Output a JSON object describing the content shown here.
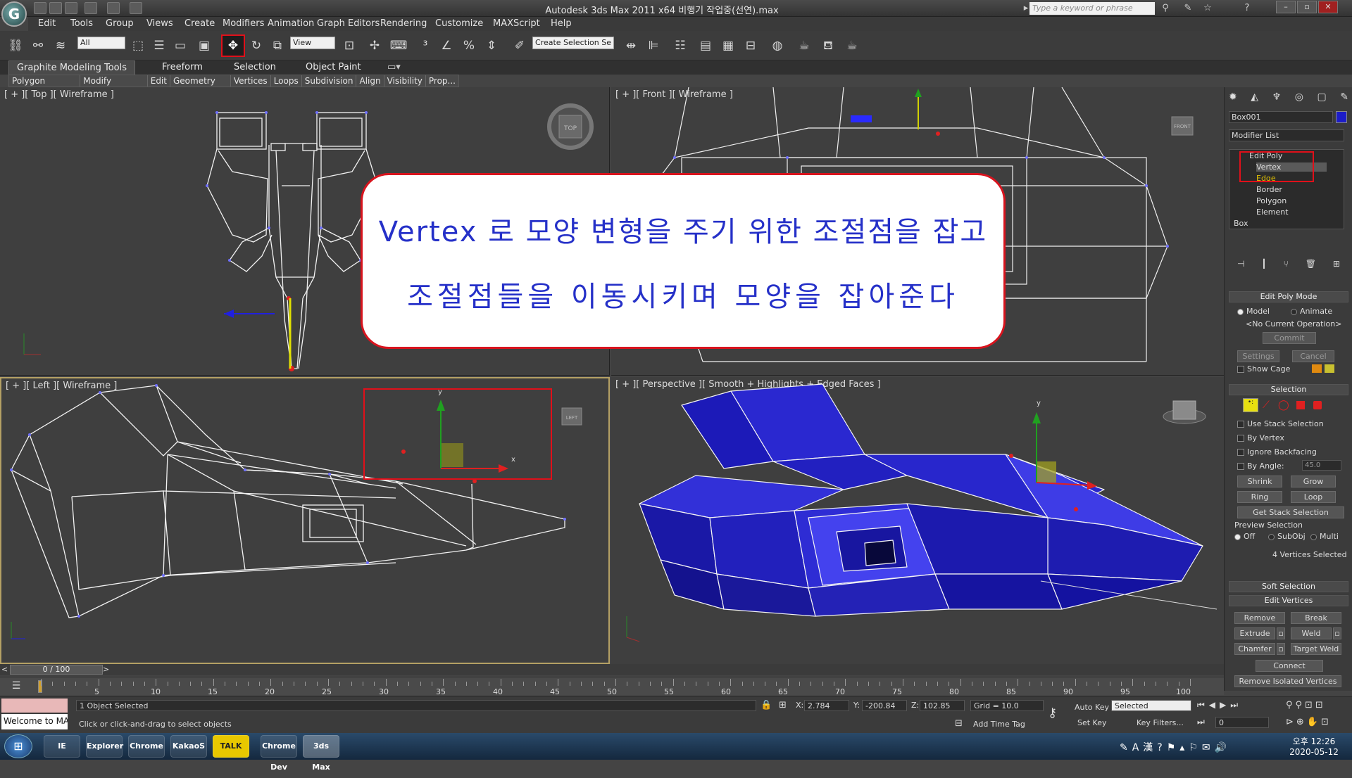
{
  "window": {
    "title": "Autodesk 3ds Max  2011 x64      비행기 작업중(선연).max",
    "search_placeholder": "Type a keyword or phrase"
  },
  "menu": [
    "Edit",
    "Tools",
    "Group",
    "Views",
    "Create",
    "Modifiers",
    "Animation",
    "Graph Editors",
    "Rendering",
    "Customize",
    "MAXScript",
    "Help"
  ],
  "toolbar": {
    "selection_filter": "All",
    "reference_coord": "View",
    "named_selection": "Create Selection Se"
  },
  "ribbon": {
    "tabs": [
      "Graphite Modeling Tools",
      "Freeform",
      "Selection",
      "Object Paint"
    ],
    "subtabs": [
      "Polygon Modeling",
      "Modify Selection",
      "Edit",
      "Geometry (All)",
      "Vertices",
      "Loops",
      "Subdivision",
      "Align",
      "Visibility",
      "Prop..."
    ]
  },
  "viewports": {
    "top_label": "[ + ][ Top ][ Wireframe ]",
    "front_label": "[ + ][ Front ][ Wireframe ]",
    "left_label": "[ + ][ Left ][ Wireframe ]",
    "persp_label": "[ + ][ Perspective ][ Smooth + Highlights + Edged Faces ]",
    "viewcube_top": "TOP",
    "viewcube_front": "FRONT",
    "viewcube_left": "LEFT"
  },
  "overlay": {
    "line1": "Vertex 로 모양 변형을 주기 위한 조절점을 잡고",
    "line2": "조절점들을 이동시키며 모양을 잡아준다"
  },
  "command_panel": {
    "object_name": "Box001",
    "object_color": "#1c1cc8",
    "modifier_list": "Modifier List",
    "stack": [
      "Edit Poly",
      "Vertex",
      "Edge",
      "Border",
      "Polygon",
      "Element",
      "Box"
    ],
    "edit_poly_mode": "Edit Poly Mode",
    "mode_model": "Model",
    "mode_animate": "Animate",
    "no_current_op": "<No Current Operation>",
    "commit": "Commit",
    "settings": "Settings",
    "cancel": "Cancel",
    "show_cage": "Show Cage",
    "selection_title": "Selection",
    "use_stack_selection": "Use Stack Selection",
    "by_vertex": "By Vertex",
    "ignore_backfacing": "Ignore Backfacing",
    "by_angle": "By Angle:",
    "by_angle_value": "45.0",
    "shrink": "Shrink",
    "grow": "Grow",
    "ring": "Ring",
    "loop": "Loop",
    "get_stack_selection": "Get Stack Selection",
    "preview_selection": "Preview Selection",
    "preview_off": "Off",
    "preview_subobj": "SubObj",
    "preview_multi": "Multi",
    "vertices_selected": "4 Vertices Selected",
    "soft_selection": "Soft Selection",
    "edit_vertices": "Edit Vertices",
    "remove": "Remove",
    "break": "Break",
    "extrude": "Extrude",
    "weld": "Weld",
    "chamfer": "Chamfer",
    "target_weld": "Target Weld",
    "connect": "Connect",
    "remove_isolated": "Remove Isolated Vertices"
  },
  "timeline": {
    "frame_display": "0 / 100",
    "ticks": [
      "5",
      "10",
      "15",
      "20",
      "25",
      "30",
      "35",
      "40",
      "45",
      "50",
      "55",
      "60",
      "65",
      "70",
      "75",
      "80",
      "85",
      "90",
      "95",
      "100"
    ]
  },
  "status": {
    "welcome": "Welcome to MA",
    "objects_selected": "1 Object Selected",
    "prompt": "Click or click-and-drag to select objects",
    "x_value": "2.784",
    "y_value": "-200.84",
    "z_value": "102.85",
    "grid": "Grid = 10.0",
    "add_time_tag": "Add Time Tag",
    "auto_key": "Auto Key",
    "set_key": "Set Key",
    "key_mode": "Selected",
    "key_filters": "Key Filters...",
    "frame": "0"
  },
  "taskbar": {
    "time": "오후 12:26",
    "date": "2020-05-12",
    "apps": [
      "IE",
      "Explorer",
      "Chrome",
      "KakaoS",
      "TALK",
      "Chrome Dev",
      "3ds Max"
    ]
  }
}
